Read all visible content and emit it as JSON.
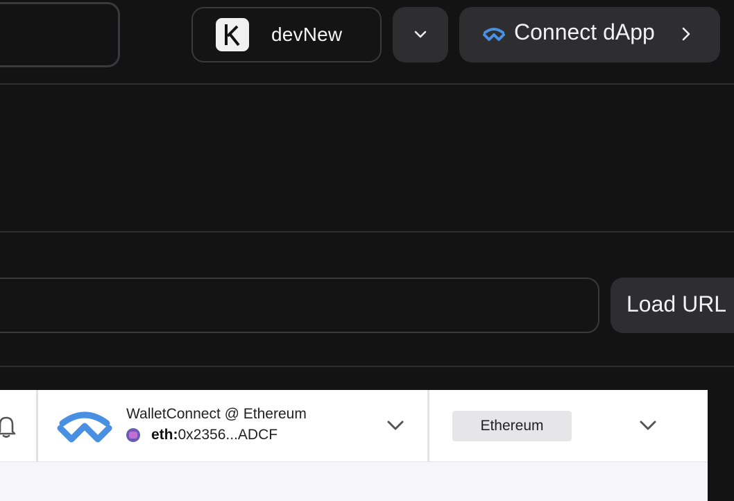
{
  "header": {
    "account_name": "devNew",
    "connect_label": "Connect dApp"
  },
  "url_bar": {
    "load_label": "Load URL"
  },
  "wallet": {
    "title": "WalletConnect @ Ethereum",
    "chain_prefix": "eth:",
    "address": "0x2356...ADCF",
    "network": "Ethereum"
  },
  "icons": {
    "account_logo": "k-logo-icon",
    "connect": "walletconnect-icon",
    "bell": "bell-icon",
    "chevron": "chevron-down-icon"
  },
  "colors": {
    "background": "#131314",
    "button": "#2e2e30",
    "accent": "#4a90e2"
  }
}
